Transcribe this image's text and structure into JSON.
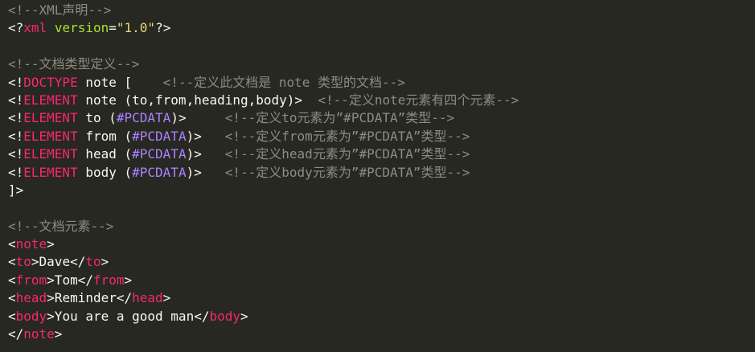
{
  "editor": {
    "lines": [
      [
        {
          "t": "<!--XML声明-->",
          "k": "comment"
        }
      ],
      [
        {
          "t": "<?",
          "k": "text"
        },
        {
          "t": "xml",
          "k": "tag"
        },
        {
          "t": " ",
          "k": "text"
        },
        {
          "t": "version",
          "k": "attr"
        },
        {
          "t": "=",
          "k": "text"
        },
        {
          "t": "\"1.0\"",
          "k": "str"
        },
        {
          "t": "?>",
          "k": "text"
        }
      ],
      [],
      [
        {
          "t": "<!--文档类型定义-->",
          "k": "comment"
        }
      ],
      [
        {
          "t": "<!",
          "k": "text"
        },
        {
          "t": "DOCTYPE",
          "k": "tag"
        },
        {
          "t": " note [    ",
          "k": "text"
        },
        {
          "t": "<!--定义此文档是 note 类型的文档-->",
          "k": "comment"
        }
      ],
      [
        {
          "t": "<!",
          "k": "text"
        },
        {
          "t": "ELEMENT",
          "k": "tag"
        },
        {
          "t": " note (to,from,heading,body)>  ",
          "k": "text"
        },
        {
          "t": "<!--定义note元素有四个元素-->",
          "k": "comment"
        }
      ],
      [
        {
          "t": "<!",
          "k": "text"
        },
        {
          "t": "ELEMENT",
          "k": "tag"
        },
        {
          "t": " to (",
          "k": "text"
        },
        {
          "t": "#PCDATA",
          "k": "const"
        },
        {
          "t": ")>     ",
          "k": "text"
        },
        {
          "t": "<!--定义to元素为”#PCDATA”类型-->",
          "k": "comment"
        }
      ],
      [
        {
          "t": "<!",
          "k": "text"
        },
        {
          "t": "ELEMENT",
          "k": "tag"
        },
        {
          "t": " from (",
          "k": "text"
        },
        {
          "t": "#PCDATA",
          "k": "const"
        },
        {
          "t": ")>   ",
          "k": "text"
        },
        {
          "t": "<!--定义from元素为”#PCDATA”类型-->",
          "k": "comment"
        }
      ],
      [
        {
          "t": "<!",
          "k": "text"
        },
        {
          "t": "ELEMENT",
          "k": "tag"
        },
        {
          "t": " head (",
          "k": "text"
        },
        {
          "t": "#PCDATA",
          "k": "const"
        },
        {
          "t": ")>   ",
          "k": "text"
        },
        {
          "t": "<!--定义head元素为”#PCDATA”类型-->",
          "k": "comment"
        }
      ],
      [
        {
          "t": "<!",
          "k": "text"
        },
        {
          "t": "ELEMENT",
          "k": "tag"
        },
        {
          "t": " body (",
          "k": "text"
        },
        {
          "t": "#PCDATA",
          "k": "const"
        },
        {
          "t": ")>   ",
          "k": "text"
        },
        {
          "t": "<!--定义body元素为”#PCDATA”类型-->",
          "k": "comment"
        }
      ],
      [
        {
          "t": "]>",
          "k": "text"
        }
      ],
      [],
      [
        {
          "t": "<!--文档元素-->",
          "k": "comment"
        }
      ],
      [
        {
          "t": "<",
          "k": "text"
        },
        {
          "t": "note",
          "k": "tag"
        },
        {
          "t": ">",
          "k": "text"
        }
      ],
      [
        {
          "t": "<",
          "k": "text"
        },
        {
          "t": "to",
          "k": "tag"
        },
        {
          "t": ">Dave</",
          "k": "text"
        },
        {
          "t": "to",
          "k": "tag"
        },
        {
          "t": ">",
          "k": "text"
        }
      ],
      [
        {
          "t": "<",
          "k": "text"
        },
        {
          "t": "from",
          "k": "tag"
        },
        {
          "t": ">Tom</",
          "k": "text"
        },
        {
          "t": "from",
          "k": "tag"
        },
        {
          "t": ">",
          "k": "text"
        }
      ],
      [
        {
          "t": "<",
          "k": "text"
        },
        {
          "t": "head",
          "k": "tag"
        },
        {
          "t": ">Reminder</",
          "k": "text"
        },
        {
          "t": "head",
          "k": "tag"
        },
        {
          "t": ">",
          "k": "text"
        }
      ],
      [
        {
          "t": "<",
          "k": "text"
        },
        {
          "t": "body",
          "k": "tag"
        },
        {
          "t": ">You are a good man</",
          "k": "text"
        },
        {
          "t": "body",
          "k": "tag"
        },
        {
          "t": ">",
          "k": "text"
        }
      ],
      [
        {
          "t": "</",
          "k": "text"
        },
        {
          "t": "note",
          "k": "tag"
        },
        {
          "t": ">",
          "k": "text"
        }
      ]
    ]
  },
  "colors": {
    "background": "#272822",
    "text": "#f8f8f2",
    "comment": "#8e8c7e",
    "tag": "#f92672",
    "attr": "#a6e22e",
    "string": "#e6db74",
    "constant": "#ae81ff"
  }
}
